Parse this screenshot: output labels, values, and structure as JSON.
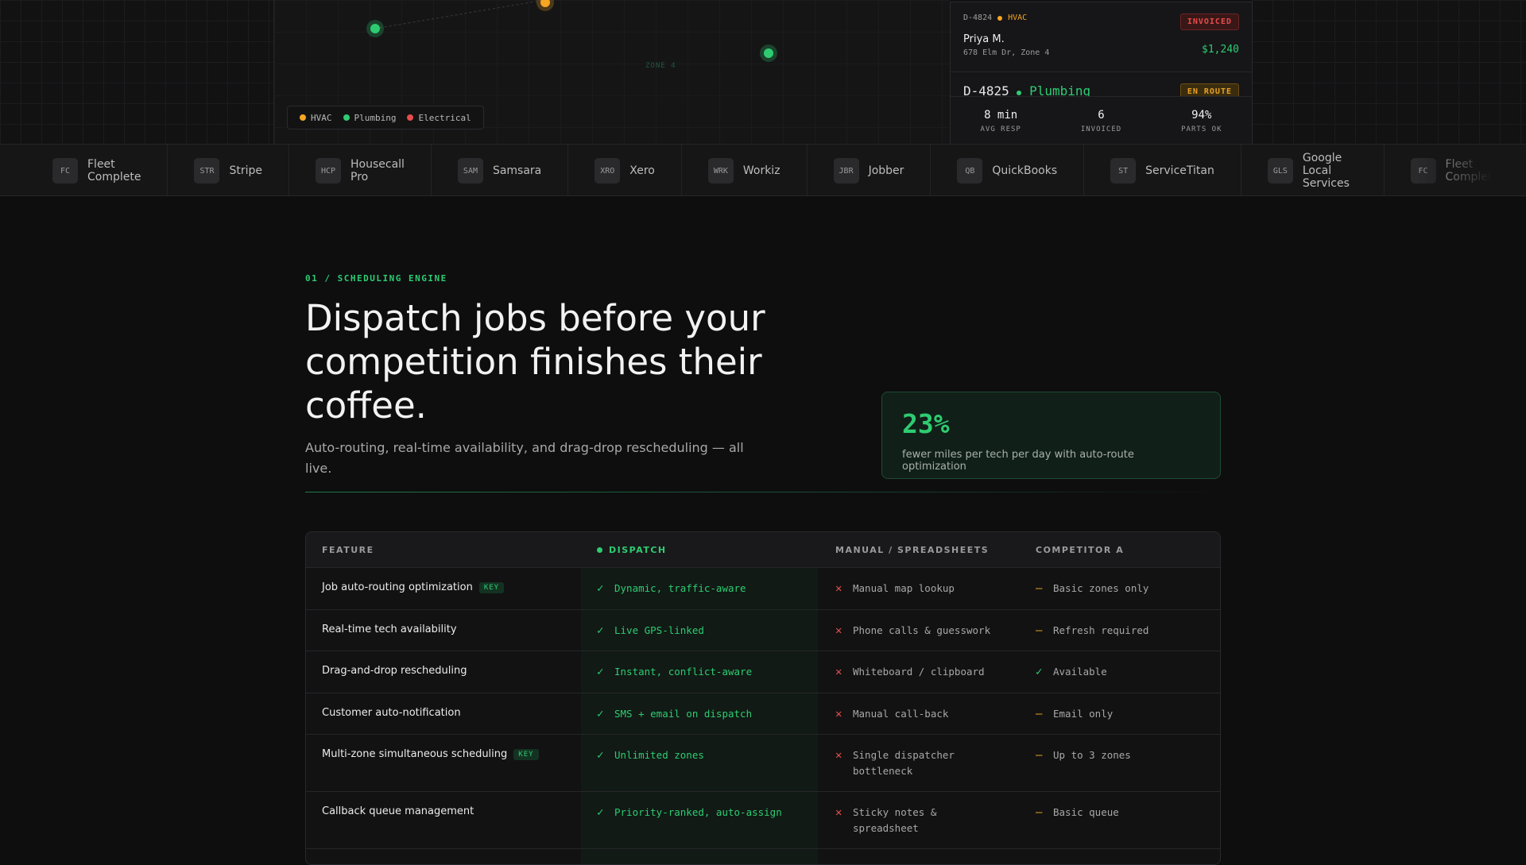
{
  "map": {
    "zone_label": "ZONE 4",
    "legend": [
      {
        "label": "HVAC",
        "color": "#f5a623"
      },
      {
        "label": "Plumbing",
        "color": "#2ecc71"
      },
      {
        "label": "Electrical",
        "color": "#e74c4c"
      }
    ]
  },
  "jobs": [
    {
      "id": "D-4824",
      "category": "HVAC",
      "category_color": "#f5a623",
      "status": "INVOICED",
      "name": "Priya M.",
      "address": "678 Elm Dr, Zone 4",
      "amount": "$1,240"
    },
    {
      "id": "D-4825",
      "category": "Plumbing",
      "category_color": "#2ecc71",
      "status": "EN ROUTE"
    }
  ],
  "stats": [
    {
      "value": "8 min",
      "label": "AVG RESP"
    },
    {
      "value": "6",
      "label": "INVOICED"
    },
    {
      "value": "94%",
      "label": "PARTS OK"
    }
  ],
  "integrations": [
    {
      "abbr": "FC",
      "name": "Fleet Complete"
    },
    {
      "abbr": "STR",
      "name": "Stripe"
    },
    {
      "abbr": "HCP",
      "name": "Housecall Pro"
    },
    {
      "abbr": "SAM",
      "name": "Samsara"
    },
    {
      "abbr": "XRO",
      "name": "Xero"
    },
    {
      "abbr": "WRK",
      "name": "Workiz"
    },
    {
      "abbr": "JBR",
      "name": "Jobber"
    },
    {
      "abbr": "QB",
      "name": "QuickBooks"
    },
    {
      "abbr": "ST",
      "name": "ServiceTitan"
    },
    {
      "abbr": "GLS",
      "name": "Google Local Services"
    },
    {
      "abbr": "FC",
      "name": "Fleet Complete"
    }
  ],
  "section": {
    "eyebrow": "01 / SCHEDULING ENGINE",
    "headline": "Dispatch jobs before your competition finishes their coffee.",
    "subhead": "Auto-routing, real-time availability, and drag-drop rescheduling — all live."
  },
  "stat_card": {
    "value": "23%",
    "caption": "fewer miles per tech per day with auto-route optimization"
  },
  "table": {
    "headers": [
      "FEATURE",
      "DISPATCH",
      "MANUAL / SPREADSHEETS",
      "COMPETITOR A"
    ],
    "rows": [
      {
        "feature": "Job auto-routing optimization",
        "key": "KEY",
        "dispatch": "Dynamic, traffic-aware",
        "manual": "Manual map lookup",
        "competitor": "Basic zones only",
        "competitor_status": "partial"
      },
      {
        "feature": "Real-time tech availability",
        "key": "",
        "dispatch": "Live GPS-linked",
        "manual": "Phone calls & guesswork",
        "competitor": "Refresh required",
        "competitor_status": "partial"
      },
      {
        "feature": "Drag-and-drop rescheduling",
        "key": "",
        "dispatch": "Instant, conflict-aware",
        "manual": "Whiteboard / clipboard",
        "competitor": "Available",
        "competitor_status": "yes"
      },
      {
        "feature": "Customer auto-notification",
        "key": "",
        "dispatch": "SMS + email on dispatch",
        "manual": "Manual call-back",
        "competitor": "Email only",
        "competitor_status": "partial"
      },
      {
        "feature": "Multi-zone simultaneous scheduling",
        "key": "KEY",
        "dispatch": "Unlimited zones",
        "manual": "Single dispatcher bottleneck",
        "competitor": "Up to 3 zones",
        "competitor_status": "partial"
      },
      {
        "feature": "Callback queue management",
        "key": "",
        "dispatch": "Priority-ranked, auto-assign",
        "manual": "Sticky notes & spreadsheet",
        "competitor": "Basic queue",
        "competitor_status": "partial"
      }
    ]
  },
  "colors": {
    "accent": "#2ecc71",
    "invoiced": "#e74c4c",
    "en_route": "#e7a225"
  }
}
